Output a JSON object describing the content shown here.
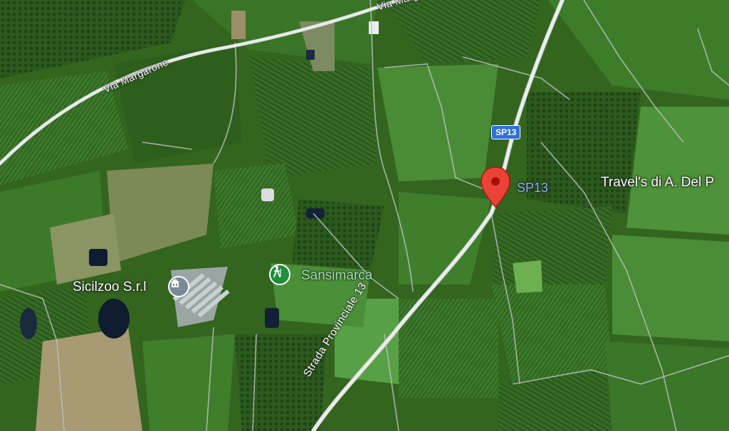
{
  "map": {
    "roads": {
      "via_margarone_top": "Via Marg",
      "via_margarone": "Via Margarone",
      "strada_provinciale": "Strada Provinciale 13",
      "sp13_label": "SP13",
      "sp13_shield": "SP13"
    },
    "places": {
      "travels": "Travel's di A. Del P",
      "sicilzoo": "Sicilzoo S.r.l",
      "sansimarca": "Sansimarca"
    },
    "icons": {
      "sicilzoo": "building-icon",
      "sansimarca": "hiking-icon",
      "selected": "location-pin-icon"
    },
    "colors": {
      "pin_red": "#ea4335",
      "pin_dark": "#a50e0e",
      "shield_blue": "#2e6fdc",
      "poi_green": "#1e8e3e",
      "poi_gray": "#7b8a99",
      "poi_text_green": "#9fe3a9"
    }
  }
}
